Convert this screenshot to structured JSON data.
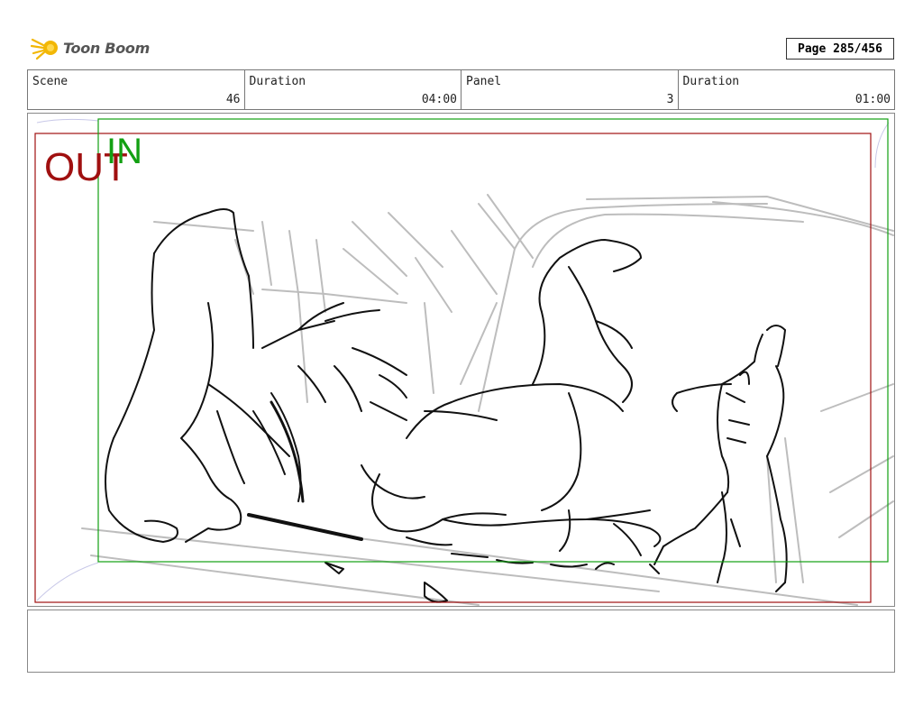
{
  "logo": {
    "text": "Toon Boom",
    "icon": "comet-icon"
  },
  "page": {
    "label": "Page 285/456"
  },
  "info": [
    {
      "label": "Scene",
      "value": "46"
    },
    {
      "label": "Duration",
      "value": "04:00"
    },
    {
      "label": "Panel",
      "value": "3"
    },
    {
      "label": "Duration",
      "value": "01:00"
    }
  ],
  "panel": {
    "out_label": "OUT",
    "in_label": "IN",
    "out_frame_color": "#a01010",
    "in_frame_color": "#12a012",
    "sketch": "storyboard-sketch"
  },
  "notes": {
    "text": ""
  }
}
